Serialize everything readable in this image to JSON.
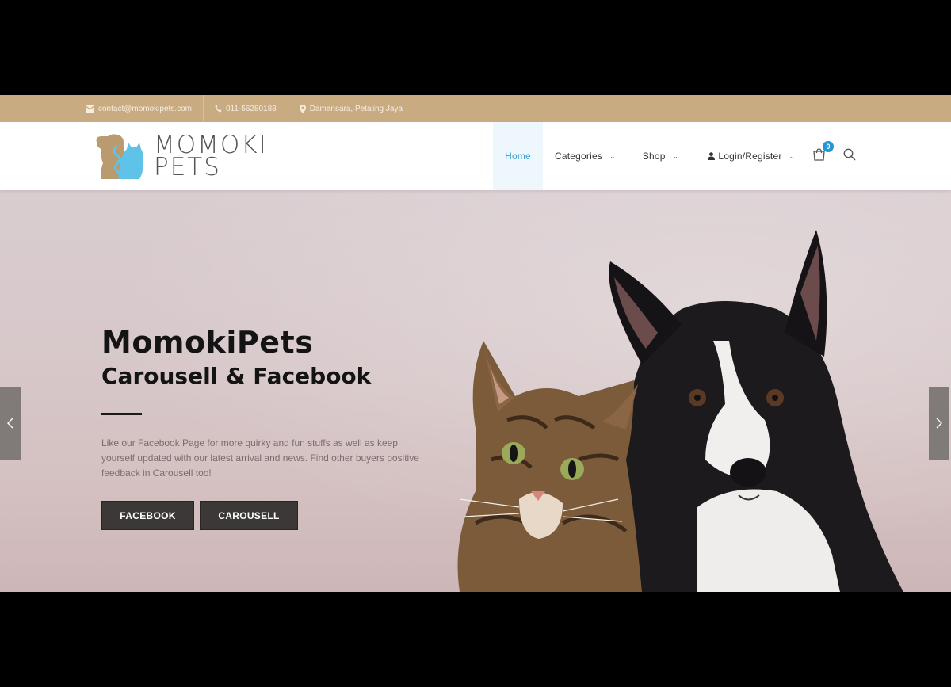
{
  "topbar": {
    "email": "contact@momokipets.com",
    "phone": "011-56280188",
    "location": "Damansara, Petaling Jaya",
    "icons": [
      "envelope-icon",
      "phone-icon",
      "map-marker-icon"
    ]
  },
  "header": {
    "logo_line1": "MOMOKI",
    "logo_line2": "PETS",
    "nav": {
      "home": "Home",
      "categories": "Categories",
      "shop": "Shop",
      "login": "Login/Register"
    },
    "cart_count": "0"
  },
  "hero": {
    "title": "MomokiPets",
    "subtitle": "Carousell & Facebook",
    "description": "Like our Facebook Page for more quirky and fun stuffs as well as keep yourself updated with our latest arrival and news. Find other buyers positive feedback in Carousell too!",
    "button_facebook": "FACEBOOK",
    "button_carousell": "CAROUSELL"
  },
  "colors": {
    "topbar": "#c9ab82",
    "accent": "#3a9fd6",
    "button": "#3d3838"
  }
}
